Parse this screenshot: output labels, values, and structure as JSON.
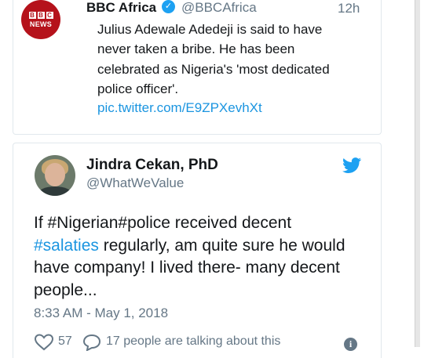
{
  "top_tweet": {
    "author_name": "BBC Africa",
    "author_handle": "@BBCAfrica",
    "time": "12h",
    "logo": {
      "line1": [
        "B",
        "B",
        "C"
      ],
      "line2": "NEWS"
    },
    "text_lines": [
      "Julius Adewale Adedeji is said to have",
      "never taken a bribe. He has been",
      "celebrated as Nigeria's 'most dedicated",
      "police officer'."
    ],
    "link": "pic.twitter.com/E9ZPXevhXt"
  },
  "main_tweet": {
    "author_name": "Jindra Cekan, PhD",
    "author_handle": "@WhatWeValue",
    "text": {
      "part1": "If #Nigerian#police received decent",
      "hashtag": "#salaties",
      "part2": " regularly, am quite sure he would have company! I lived there- many decent people..."
    },
    "timestamp": "8:33 AM - May 1, 2018",
    "like_count": "57",
    "talking_text": "17 people are talking about this"
  },
  "colors": {
    "brand_blue": "#1da1f2",
    "link_blue": "#1b95e0",
    "bbc_red": "#b5121b",
    "muted_text": "#657786"
  },
  "icons": [
    "verified-badge-icon",
    "twitter-bird-icon",
    "heart-icon",
    "comment-bubble-icon",
    "info-icon"
  ]
}
